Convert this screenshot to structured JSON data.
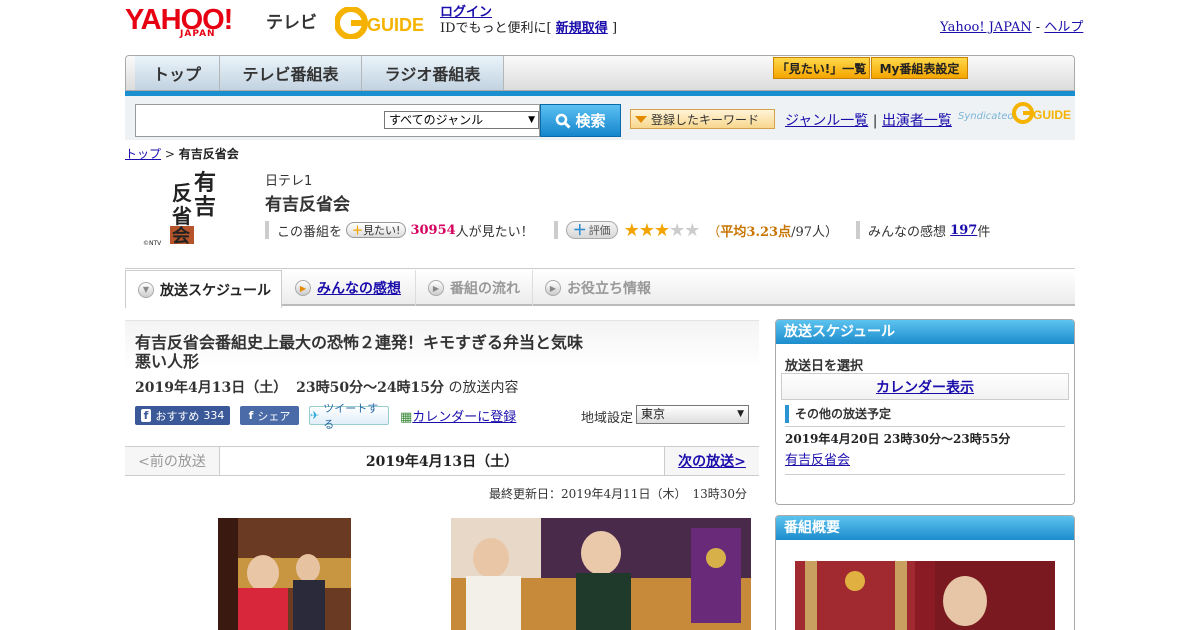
{
  "header": {
    "yahoo_logo": "YAHOO!",
    "yahoo_sub": "JAPAN",
    "tv_label": "テレビ",
    "gguide_logo": "G-GUIDE",
    "login_link": "ログイン",
    "login_text": "IDでもっと便利に[",
    "register_link": "新規取得",
    "login_close": "]",
    "yahoo_japan_link": "Yahoo! JAPAN",
    "separator": "-",
    "help_link": "ヘルプ"
  },
  "nav": {
    "tabs": [
      {
        "label": "トップ"
      },
      {
        "label": "テレビ番組表"
      },
      {
        "label": "ラジオ番組表"
      }
    ],
    "mitai_list": "「見たい!」一覧",
    "my_schedule": "My番組表設定"
  },
  "search": {
    "genre_selected": "すべてのジャンル",
    "button_label": "検索",
    "keyword_button": "登録したキーワード",
    "genre_list_link": "ジャンル一覧",
    "pipe": "|",
    "performer_link": "出演者一覧",
    "syndicated": "Syndicated"
  },
  "breadcrumb": {
    "top": "トップ",
    "sep": ">",
    "current": "有吉反省会"
  },
  "program": {
    "logo_text": "有吉反省会",
    "logo_copyright": "©NTV",
    "channel": "日テレ1",
    "title": "有吉反省会",
    "this_program": "この番組を",
    "mitai_button": "見たい!",
    "mitai_count": "30954",
    "mitai_suffix": "人が見たい！",
    "rating_button": "評価",
    "rating_value": 3.23,
    "rating_open": "（",
    "rating_avg": "平均3.23点",
    "rating_count": "/97人）",
    "kansou_label": "みんなの感想",
    "kansou_count": "197",
    "kansou_suffix": "件"
  },
  "subtabs": [
    {
      "label": "放送スケジュール"
    },
    {
      "label": "みんなの感想"
    },
    {
      "label": "番組の流れ"
    },
    {
      "label": "お役立ち情報"
    }
  ],
  "episode": {
    "title": "有吉反省会番組史上最大の恐怖２連発！キモすぎる弁当と気味悪い人形",
    "date": "2019年4月13日（土）",
    "time": "23時50分～24時15分",
    "content_suffix": "の放送内容",
    "fb_recommend": "おすすめ",
    "fb_count": "334",
    "fb_share": "シェア",
    "tweet": "ツイートする",
    "calendar_register": "カレンダーに登録",
    "region_label": "地域設定",
    "region_value": "東京",
    "prev": "<前の放送",
    "pager_date": "2019年4月13日（土）",
    "next": "次の放送>",
    "updated": "最終更新日：2019年4月11日（木）　13時30分"
  },
  "sidebar": {
    "schedule_head": "放送スケジュール",
    "select_date": "放送日を選択",
    "calendar_button": "カレンダー表示",
    "other_head": "その他の放送予定",
    "other_date": "2019年4月20日  23時30分～23時55分",
    "other_link": "有吉反省会",
    "summary_head": "番組概要"
  },
  "colors": {
    "accent_blue": "#1a8fd0",
    "yahoo_red": "#e60012",
    "mitai_pink": "#d6005f",
    "star_orange": "#f3a400"
  }
}
